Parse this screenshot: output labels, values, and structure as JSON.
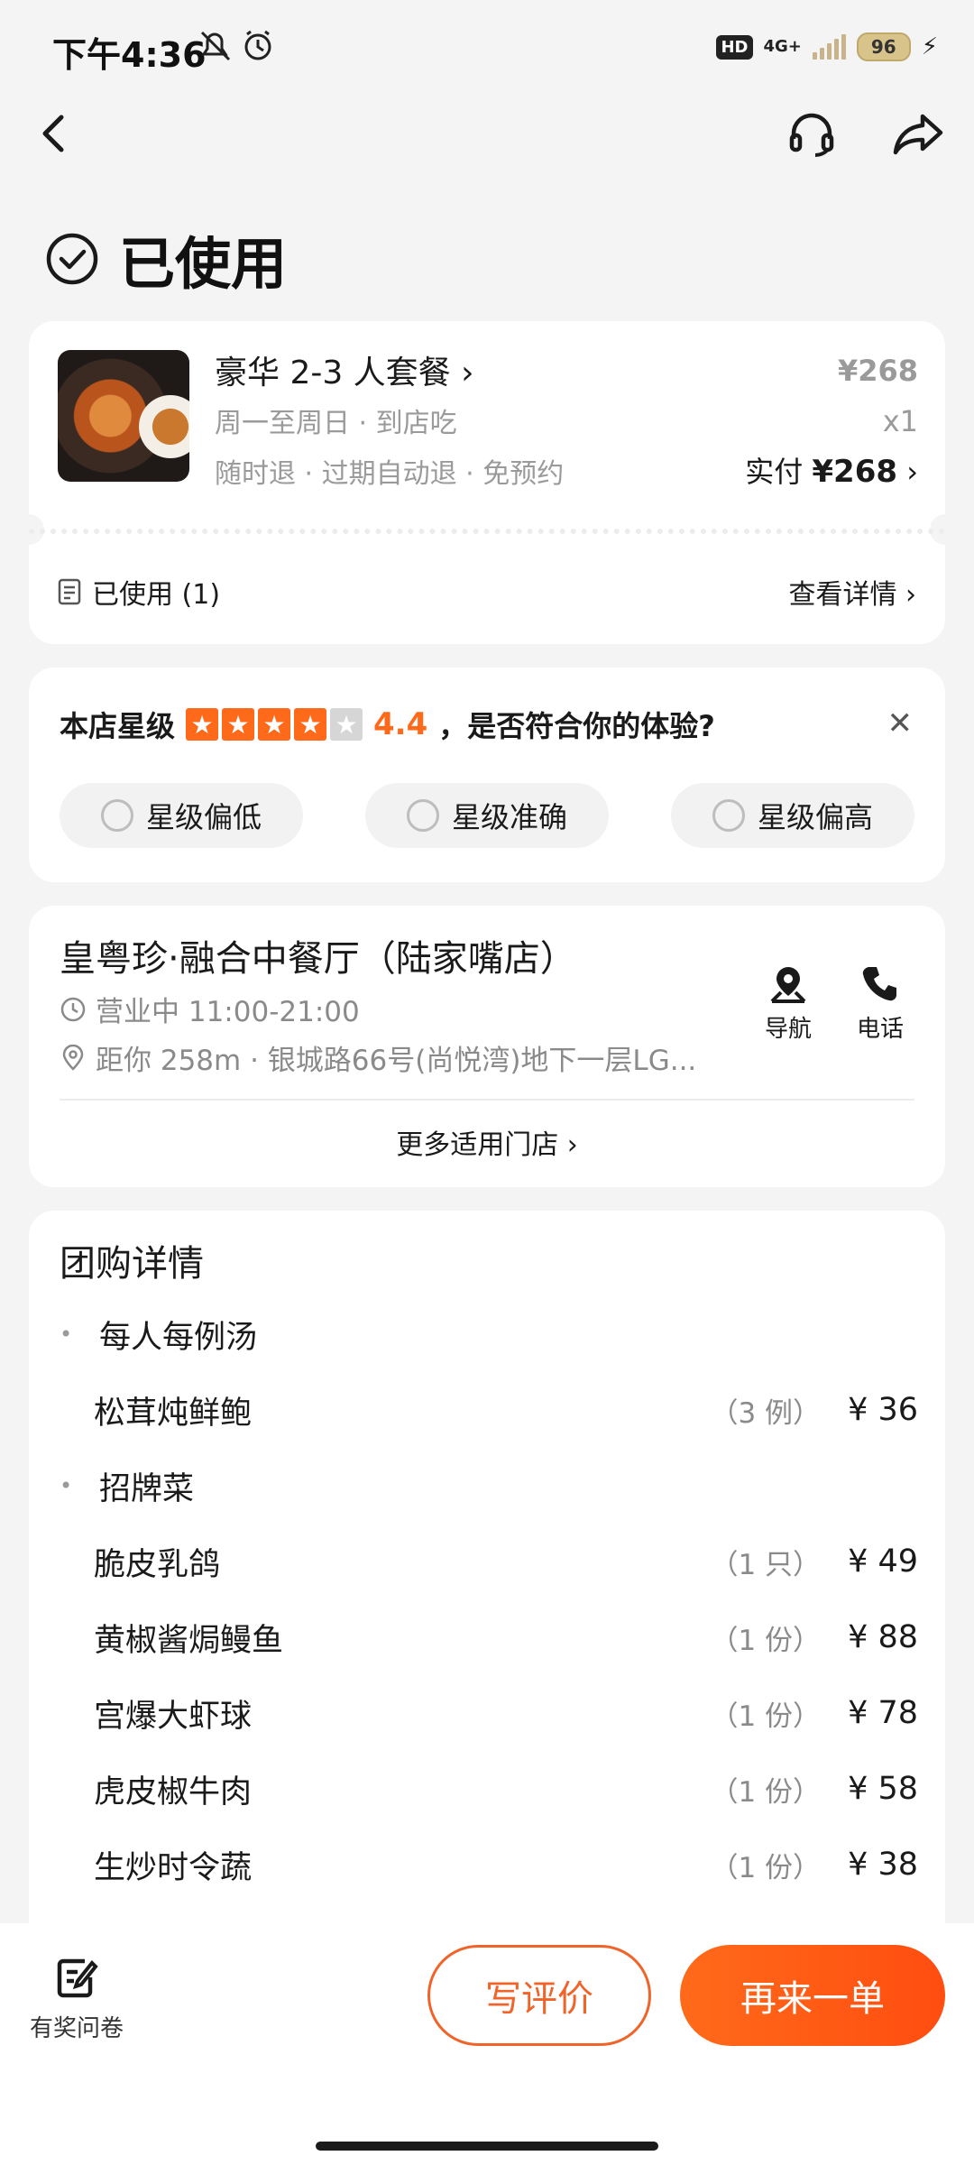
{
  "status_bar": {
    "time": "下午4:36",
    "hd": "HD",
    "network": "4G+",
    "battery": "96"
  },
  "header": {
    "status_title": "已使用"
  },
  "order": {
    "title": "豪华 2-3 人套餐",
    "subtitle": "周一至周日 · 到店吃",
    "policies": "随时退 · 过期自动退 · 免预约",
    "original_price": "¥268",
    "quantity": "x1",
    "paid_label": "实付",
    "paid_amount": "¥268",
    "used_label": "已使用 (1)",
    "detail_link": "查看详情"
  },
  "rating": {
    "label": "本店星级",
    "score": "4.4",
    "stars_filled": 4,
    "stars_total": 5,
    "question": "，是否符合你的体验?",
    "options": [
      "星级偏低",
      "星级准确",
      "星级偏高"
    ]
  },
  "shop": {
    "name": "皇粤珍·融合中餐厅（陆家嘴店）",
    "hours": "营业中 11:00-21:00",
    "address": "距你 258m · 银城路66号(尚悦湾)地下一层LG...",
    "nav_label": "导航",
    "phone_label": "电话",
    "more_stores": "更多适用门店"
  },
  "group_details": {
    "title": "团购详情",
    "sections": [
      {
        "heading": "每人每例汤",
        "items": [
          {
            "name": "松茸炖鲜鲍",
            "count": "（3 例）",
            "price": "¥ 36"
          }
        ]
      },
      {
        "heading": "招牌菜",
        "items": [
          {
            "name": "脆皮乳鸽",
            "count": "（1 只）",
            "price": "¥ 49"
          },
          {
            "name": "黄椒酱焗鳗鱼",
            "count": "（1 份）",
            "price": "¥ 88"
          },
          {
            "name": "宫爆大虾球",
            "count": "（1 份）",
            "price": "¥ 78"
          },
          {
            "name": "虎皮椒牛肉",
            "count": "（1 份）",
            "price": "¥ 58"
          },
          {
            "name": "生炒时令蔬",
            "count": "（1 份）",
            "price": "¥ 38"
          }
        ]
      }
    ]
  },
  "bottom": {
    "survey_label": "有奖问卷",
    "review_button": "写评价",
    "reorder_button": "再来一单"
  },
  "colors": {
    "accent": "#ff6a1a",
    "background": "#f4f4f4"
  }
}
